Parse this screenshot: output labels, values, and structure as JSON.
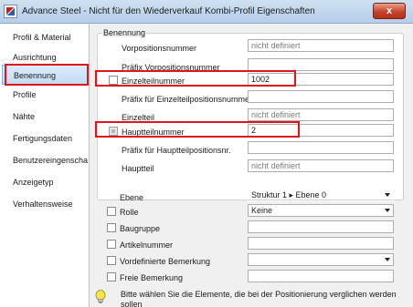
{
  "window": {
    "title": "Advance Steel - Nicht für den Wiederverkauf  Kombi-Profil Eigenschaften",
    "close_glyph": "x"
  },
  "sidebar": {
    "items": [
      {
        "label": "Profil & Material"
      },
      {
        "label": "Ausrichtung"
      },
      {
        "label": "Benennung"
      },
      {
        "label": "Profile"
      },
      {
        "label": "Nähte"
      },
      {
        "label": "Fertigungsdaten"
      },
      {
        "label": "Benutzereingenscha..."
      },
      {
        "label": "Anzeigetyp"
      },
      {
        "label": "Verhaltensweise"
      }
    ]
  },
  "benennung": {
    "title": "Benennung",
    "vorpositionsnummer": {
      "label": "Vorpositionsnummer",
      "value": "nicht definiert"
    },
    "praefix_vorposition": {
      "label": "Präfix Vorpositionsnummer",
      "value": ""
    },
    "einzelteilnummer": {
      "label": "Einzelteilnummer",
      "value": "1002",
      "checked": false
    },
    "praefix_einzelteil": {
      "label": "Präfix für Einzelteilpositionsnummer",
      "value": ""
    },
    "einzelteil": {
      "label": "Einzelteil",
      "value": "nicht definiert"
    },
    "hauptteilnummer": {
      "label": "Hauptteilnummer",
      "value": "2",
      "checked": true
    },
    "praefix_hauptteil": {
      "label": "Präfix für Hauptteilpositionsnr.",
      "value": ""
    },
    "hauptteil": {
      "label": "Hauptteil",
      "value": "nicht definiert"
    }
  },
  "criteria": {
    "ebene": {
      "label": "Ebene",
      "value": "Struktur 1  ▸  Ebene 0"
    },
    "rolle": {
      "label": "Rolle",
      "value": "Keine"
    },
    "baugruppe": {
      "label": "Baugruppe",
      "value": ""
    },
    "artikelnummer": {
      "label": "Artikelnummer",
      "value": ""
    },
    "vordefinierte_bemerkung": {
      "label": "Vordefinierte Bemerkung",
      "value": ""
    },
    "freie_bemerkung": {
      "label": "Freie Bemerkung",
      "value": ""
    }
  },
  "hint": {
    "text_line1": "Bitte wählen Sie die Elemente, die bei der Positionierung verglichen werden",
    "text_line2": "sollen"
  },
  "colors": {
    "highlight": "#e0141b",
    "accent": "#c5dcf5"
  }
}
